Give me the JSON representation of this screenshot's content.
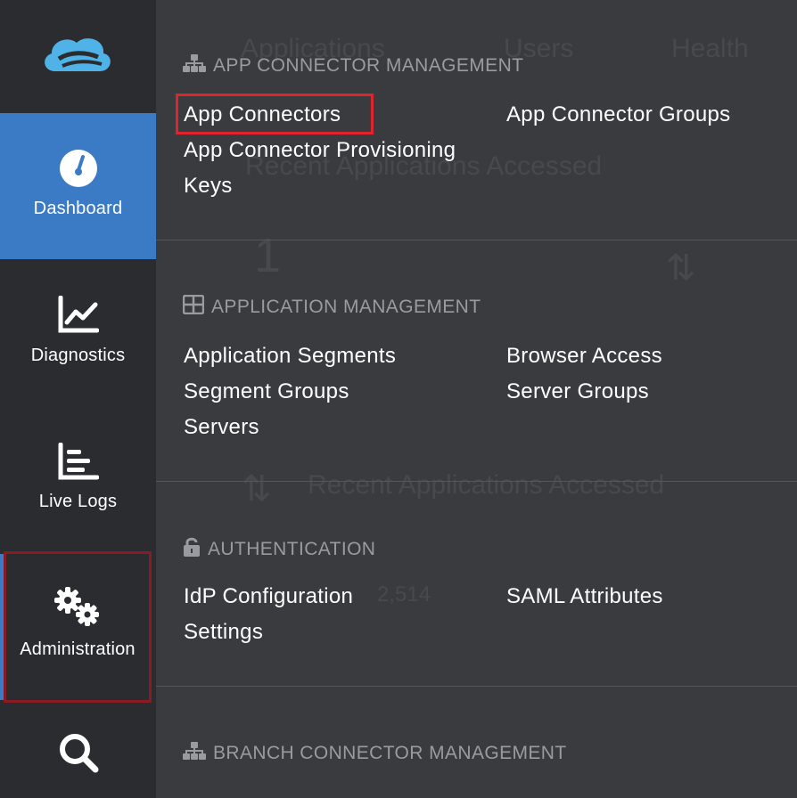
{
  "sidebar": {
    "items": [
      {
        "label": "Dashboard",
        "icon": "gauge-icon"
      },
      {
        "label": "Diagnostics",
        "icon": "line-chart-icon"
      },
      {
        "label": "Live Logs",
        "icon": "bar-list-icon"
      },
      {
        "label": "Administration",
        "icon": "gears-icon"
      },
      {
        "label": "",
        "icon": "search-icon"
      }
    ]
  },
  "background": {
    "tabs": [
      "Applications",
      "Users",
      "Health"
    ],
    "recent_title": "Recent Applications Accessed",
    "count": "1",
    "recent_title_2": "Recent Applications Accessed",
    "ghost_number": "2,514"
  },
  "menu": {
    "app_connector": {
      "title": "APP CONNECTOR MANAGEMENT",
      "links": [
        "App Connectors",
        "App Connector Groups",
        "App Connector Provisioning",
        "Keys"
      ]
    },
    "application": {
      "title": "APPLICATION MANAGEMENT",
      "links": [
        "Application Segments",
        "Browser Access",
        "Segment Groups",
        "Server Groups",
        "Servers"
      ]
    },
    "authentication": {
      "title": "AUTHENTICATION",
      "links": [
        "IdP Configuration",
        "SAML Attributes",
        "Settings"
      ]
    },
    "branch": {
      "title": "BRANCH CONNECTOR MANAGEMENT"
    }
  },
  "colors": {
    "sidebar_bg": "#2b2c30",
    "panel_bg": "#3a3b3f",
    "accent": "#3b7ac4",
    "highlight": "#e0242e"
  }
}
